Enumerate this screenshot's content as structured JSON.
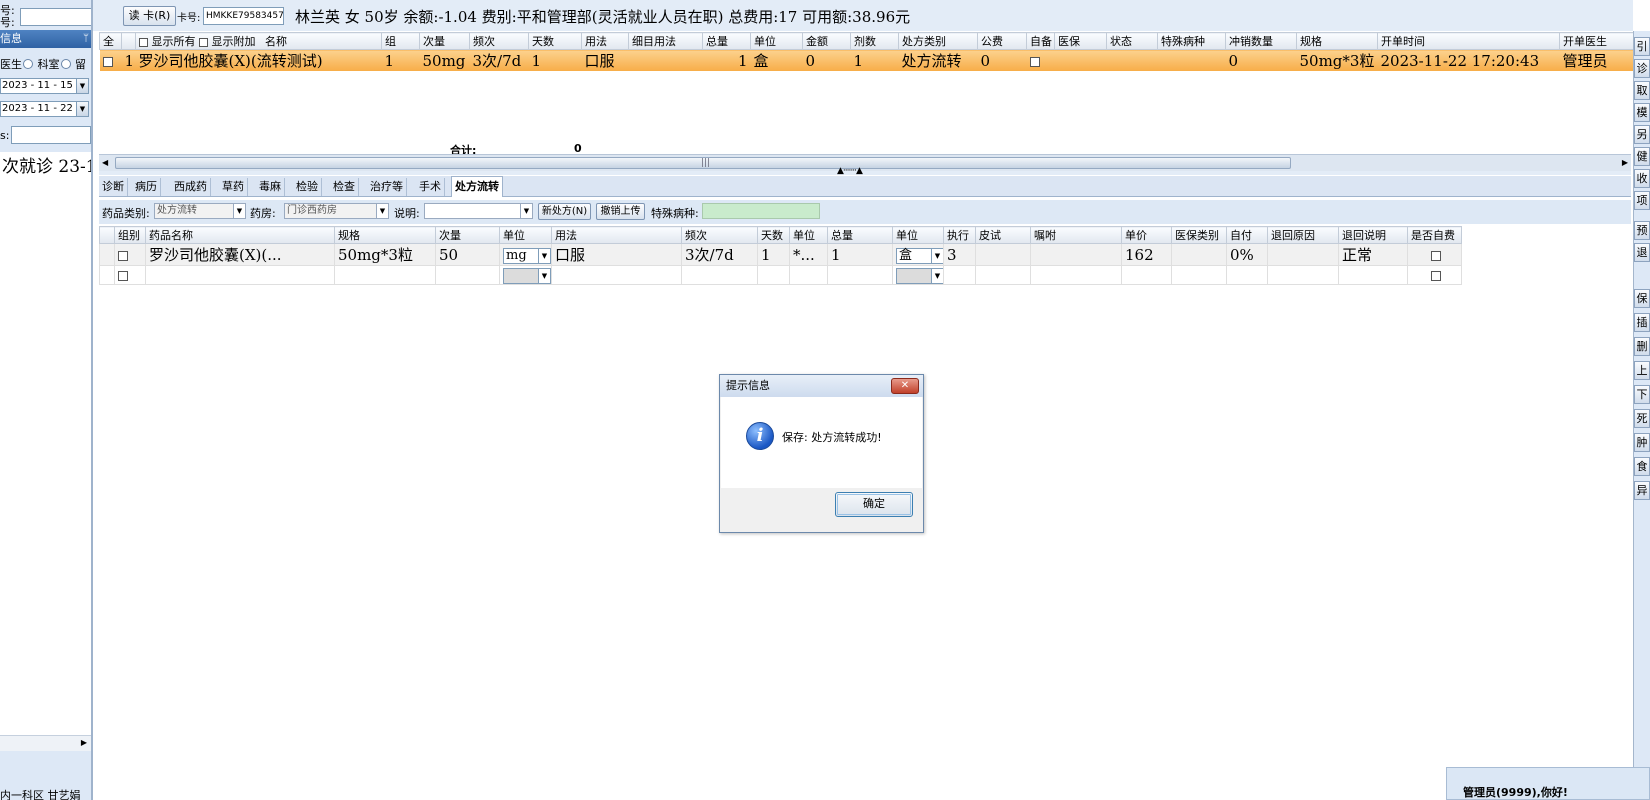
{
  "left_panel": {
    "label_no1": "号:",
    "label_no2": "号:",
    "section_title": "信息",
    "pin_icon": "pin",
    "radio_options": [
      "医生",
      "科室",
      "留"
    ],
    "date_from": "2023 - 11 - 15",
    "date_to": "2023 - 11 - 22",
    "search_label": "s:",
    "visit_item": "次就诊 23-1",
    "footer": "内一科区 甘艺娟"
  },
  "top_bar": {
    "read_card_button": "读 卡(R)",
    "card_label": "卡号:",
    "card_number": "HMKKE79583457",
    "patient_info": "林兰英 女 50岁 余额:-1.04 费别:平和管理部(灵活就业人员在职) 总费用:17 可用额:38.96元"
  },
  "upper_grid": {
    "columns": [
      "全",
      "",
      "显示所有 显示附加 名称",
      "组",
      "次量",
      "频次",
      "天数",
      "用法",
      "细目用法",
      "总量",
      "单位",
      "金额",
      "剂数",
      "处方类别",
      "公费",
      "自备",
      "医保",
      "状态",
      "特殊病种",
      "冲销数量",
      "规格",
      "开单时间",
      "开单医生"
    ],
    "show_all_label": "显示所有",
    "show_extra_label": "显示附加",
    "name_header": "名称",
    "rows": [
      {
        "index": "1",
        "name": "罗沙司他胶囊(X)(流转测试)",
        "group": "1",
        "dose": "50mg",
        "frequency": "3次/7d",
        "days": "1",
        "usage": "口服",
        "detail_usage": "",
        "total": "1",
        "unit": "盒",
        "amount": "0",
        "doses": "1",
        "rx_type": "处方流转",
        "public_fee": "0",
        "insurance": "",
        "status": "",
        "special_disease": "",
        "writeoff_qty": "0",
        "spec": "50mg*3粒",
        "order_time": "2023-11-22 17:20:43",
        "doctor": "管理员"
      }
    ],
    "totals_label": "合计:",
    "totals_value": "0"
  },
  "tabs": [
    "诊断",
    "病历",
    "西成药",
    "草药",
    "毒麻",
    "检验",
    "检查",
    "治疗等",
    "手术",
    "处方流转"
  ],
  "active_tab": "处方流转",
  "filter_bar": {
    "drug_category_label": "药品类别:",
    "drug_category_value": "处方流转",
    "pharmacy_label": "药房:",
    "pharmacy_value": "门诊西药房",
    "note_label": "说明:",
    "note_value": "",
    "new_rx_button": "新处方(N)",
    "cancel_upload_button": "撤销上传",
    "special_disease_label": "特殊病种:"
  },
  "lower_grid": {
    "columns": [
      "",
      "组别",
      "药品名称",
      "规格",
      "次量",
      "单位",
      "用法",
      "频次",
      "天数",
      "单位",
      "总量",
      "单位",
      "执行",
      "皮试",
      "嘱咐",
      "单价",
      "医保类别",
      "自付",
      "退回原因",
      "退回说明",
      "是否自费"
    ],
    "rows": [
      {
        "name": "罗沙司他胶囊(X)(...",
        "spec": "50mg*3粒",
        "dose": "50",
        "dose_unit": "mg",
        "usage": "口服",
        "frequency": "3次/7d",
        "days": "1",
        "day_unit": "*...",
        "total": "1",
        "total_unit": "盒",
        "execute": "3",
        "skin_test": "",
        "advice": "",
        "price": "162",
        "insurance_type": "",
        "self_pay": "0%",
        "return_reason": "",
        "return_note": "正常"
      }
    ]
  },
  "right_toolbar": [
    "引",
    "诊",
    "取",
    "模",
    "另",
    "健",
    "收",
    "项",
    "预",
    "退",
    "保",
    "插",
    "删",
    "上",
    "下",
    "死",
    "肿",
    "食",
    "异"
  ],
  "dialog": {
    "title": "提示信息",
    "close_icon": "close-x",
    "message": "保存: 处方流转成功!",
    "ok_button": "确定",
    "icon": "info-icon"
  },
  "status": {
    "welcome": "管理员(9999),你好!"
  },
  "colors": {
    "selected_row": "#f7ac47",
    "chrome_blue": "#dde8f6",
    "green_input": "#c9ebcc"
  }
}
